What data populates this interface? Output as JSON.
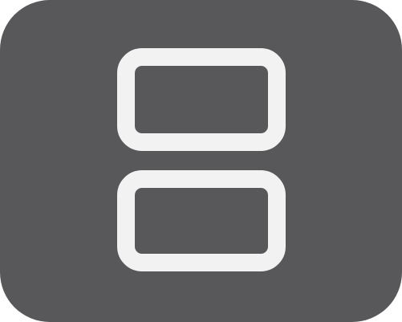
{
  "icon": {
    "name": "dual-screen-console-icon",
    "background_color": "#58585a",
    "screen_outline_color": "#f2f2f2"
  }
}
